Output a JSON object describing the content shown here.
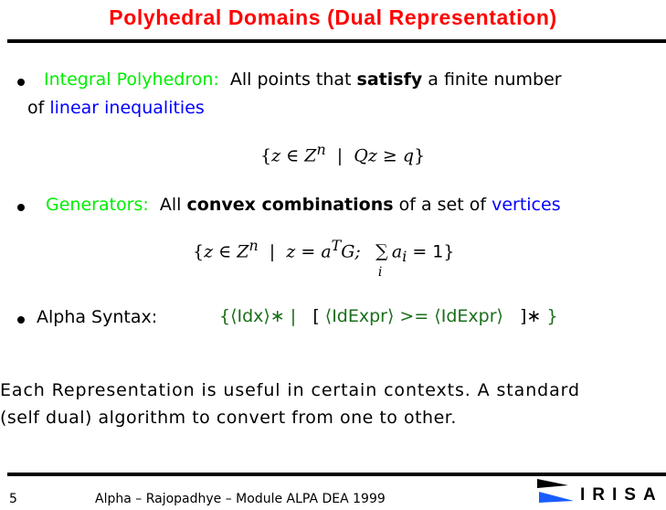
{
  "slide": {
    "title": "Polyhedral Domains (Dual Representation)",
    "bullets": [
      {
        "label": "Integral Polyhedron:",
        "text_a": "All points that",
        "bold": "satisfy",
        "text_b": "a finite number",
        "line2_a": "of",
        "line2_blue": "linear inequalities",
        "formula": {
          "open": "{",
          "var": "z",
          "in": "∈",
          "set": "Z",
          "sup": "n",
          "bar": "|",
          "lhs": "Qz",
          "op": "≥",
          "rhs": "q",
          "close": "}"
        }
      },
      {
        "label": "Generators:",
        "text_a": "All",
        "bold": "convex combinations",
        "text_b": "of a set of",
        "blue": "vertices",
        "formula": {
          "open": "{",
          "var": "z",
          "in": "∈",
          "set": "Z",
          "sup": "n",
          "bar": "|",
          "eq_lhs": "z",
          "eq": "=",
          "a": "a",
          "aT": "T",
          "G": "G;",
          "sum": "∑",
          "sum_sub": "i",
          "ai": "a",
          "ai_sub": "i",
          "eq2": "=",
          "one": "1",
          "close": "}"
        }
      },
      {
        "label": "Alpha Syntax:",
        "syntax": {
          "p1": "{⟨Idx⟩∗ |",
          "p2": "[",
          "p3": "⟨IdExpr⟩ >= ⟨IdExpr⟩",
          "p4": "]∗",
          "p5": "}"
        }
      }
    ],
    "paragraph": {
      "line1": "Each Representation is useful in certain contexts.  A standard",
      "line2": "(self dual) algorithm to convert from one to other."
    },
    "footer": {
      "page": "5",
      "text": "Alpha – Rajopadhye – Module ALPA DEA 1999",
      "logo_text": "IRISA"
    },
    "colors": {
      "title": "#ff0000",
      "label": "#00ee00",
      "emphasis": "#0000ff",
      "syntax": "#1a6e1a",
      "logo_flag_top": "#000000",
      "logo_flag_bottom": "#1a5cff"
    }
  }
}
